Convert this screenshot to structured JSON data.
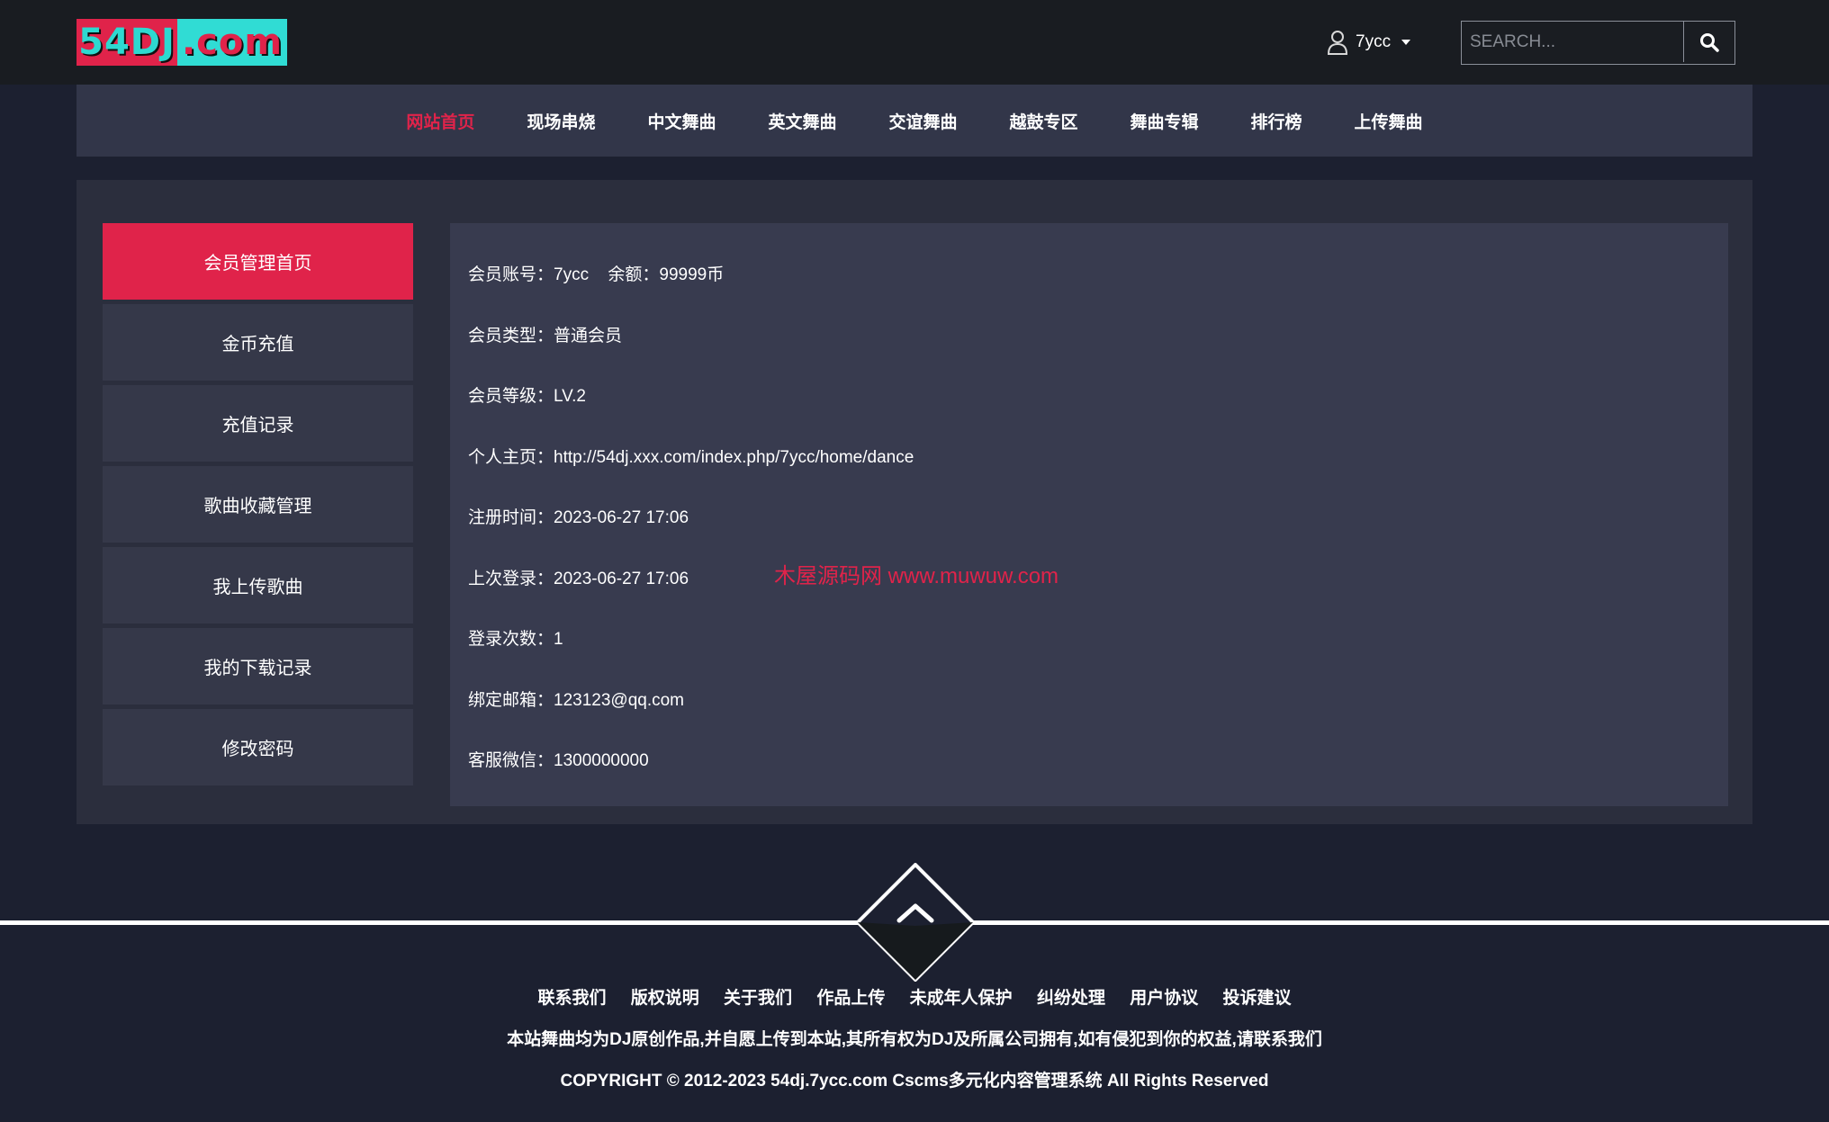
{
  "header": {
    "logo_left": "54DJ",
    "logo_right": ".com",
    "username": "7ycc",
    "search_placeholder": "SEARCH...",
    "user_icon": "user-icon",
    "search_icon": "search-icon"
  },
  "nav": {
    "items": [
      {
        "label": "网站首页",
        "active": true
      },
      {
        "label": "现场串烧"
      },
      {
        "label": "中文舞曲"
      },
      {
        "label": "英文舞曲"
      },
      {
        "label": "交谊舞曲"
      },
      {
        "label": "越鼓专区"
      },
      {
        "label": "舞曲专辑"
      },
      {
        "label": "排行榜"
      },
      {
        "label": "上传舞曲"
      }
    ]
  },
  "sidebar": {
    "items": [
      {
        "label": "会员管理首页",
        "active": true
      },
      {
        "label": "金币充值"
      },
      {
        "label": "充值记录"
      },
      {
        "label": "歌曲收藏管理"
      },
      {
        "label": "我上传歌曲"
      },
      {
        "label": "我的下载记录"
      },
      {
        "label": "修改密码"
      }
    ]
  },
  "profile": {
    "account_label": "会员账号：",
    "account": "7ycc",
    "balance_label": "余额：",
    "balance": "99999币",
    "type_label": "会员类型：",
    "type": "普通会员",
    "level_label": "会员等级：",
    "level": "LV.2",
    "homepage_label": "个人主页：",
    "homepage": "http://54dj.xxx.com/index.php/7ycc/home/dance",
    "register_label": "注册时间：",
    "register_time": "2023-06-27 17:06",
    "last_login_label": "上次登录：",
    "last_login": "2023-06-27 17:06",
    "login_count_label": "登录次数：",
    "login_count": "1",
    "email_label": "绑定邮箱：",
    "email": "123123@qq.com",
    "wechat_label": "客服微信：",
    "wechat": "1300000000"
  },
  "watermark": "木屋源码网 www.muwuw.com",
  "footer": {
    "back_to_top_icon": "chevron-up-icon",
    "links": [
      "联系我们",
      "版权说明",
      "关于我们",
      "作品上传",
      "未成年人保护",
      "纠纷处理",
      "用户协议",
      "投诉建议"
    ],
    "note": "本站舞曲均为DJ原创作品,并自愿上传到本站,其所有权为DJ及所属公司拥有,如有侵犯到你的权益,请联系我们",
    "copyright": "COPYRIGHT © 2012-2023 54dj.7ycc.com Cscms多元化内容管理系统 All Rights Reserved"
  },
  "colors": {
    "accent": "#e0234a",
    "cyan": "#30dcd4",
    "background": "#1c2030",
    "panel": "#2b2e3d",
    "card": "#383b4f"
  }
}
